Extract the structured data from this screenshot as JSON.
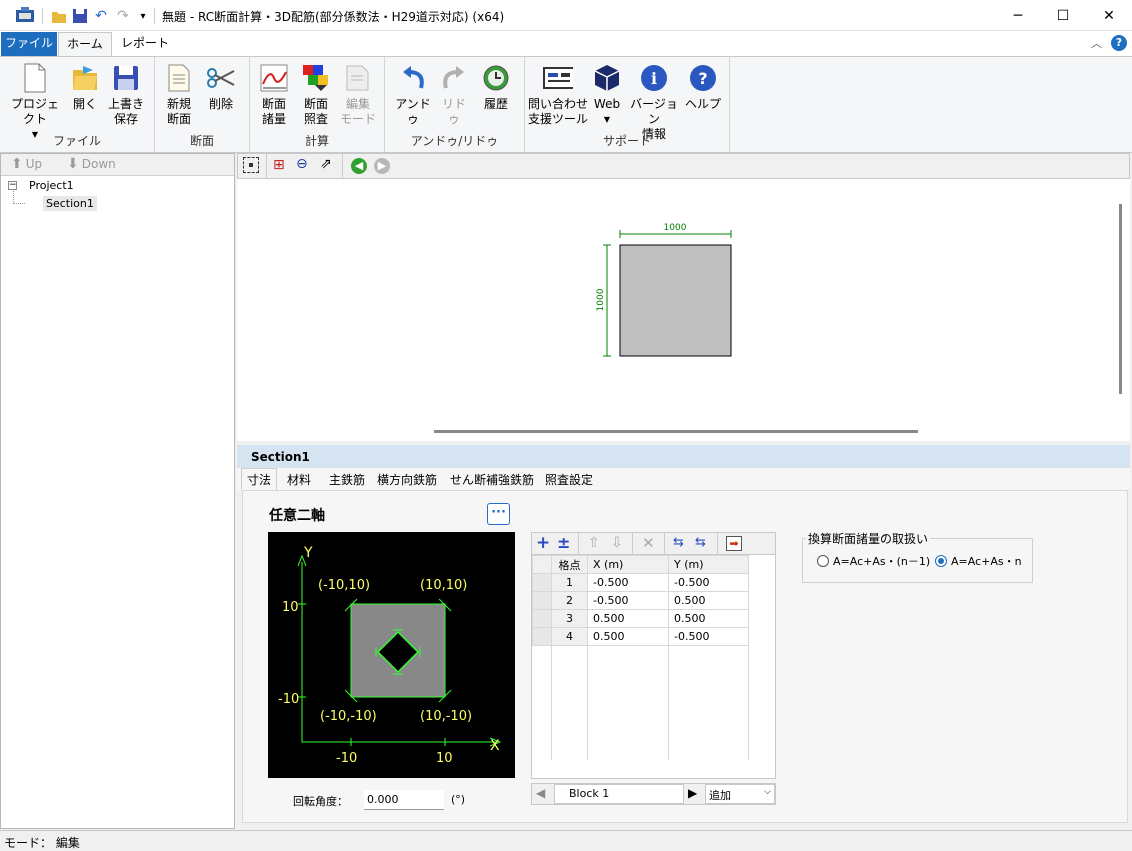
{
  "window": {
    "title": "無題 - RC断面計算・3D配筋(部分係数法・H29道示対応) (x64)",
    "minimize": "─",
    "maximize": "☐",
    "close": "✕"
  },
  "ribbon_tabs": [
    "ファイル",
    "ホーム",
    "レポート"
  ],
  "ribbon": {
    "groups": {
      "file": "ファイル",
      "section": "断面",
      "calc": "計算",
      "undo": "アンドゥ/リドゥ",
      "support": "サポート"
    },
    "buttons": {
      "project": "プロジェクト",
      "open": "開く",
      "save_l1": "上書き",
      "save_l2": "保存",
      "new_l1": "新規",
      "new_l2": "断面",
      "delete": "削除",
      "props_l1": "断面",
      "props_l2": "諸量",
      "check_l1": "断面",
      "check_l2": "照査",
      "edit_l1": "編集",
      "edit_l2": "モード",
      "undo": "アンドゥ",
      "redo": "リドゥ",
      "history": "履歴",
      "inquiry_l1": "問い合わせ",
      "inquiry_l2": "支援ツール",
      "web": "Web",
      "version_l1": "バージョン",
      "version_l2": "情報",
      "help": "ヘルプ"
    }
  },
  "left": {
    "up": "Up",
    "down": "Down",
    "tree": {
      "project": "Project1",
      "section": "Section1"
    }
  },
  "canvas": {
    "width_label": "1000",
    "height_label": "1000"
  },
  "section": {
    "title": "Section1",
    "tabs": [
      "寸法",
      "材料",
      "主鉄筋",
      "横方向鉄筋",
      "せん断補強鉄筋",
      "照査設定"
    ],
    "axis_title": "任意二軸",
    "more_button": "···",
    "diagram": {
      "y_axis": "Y",
      "x_axis": "X",
      "tick_pos": "10",
      "tick_neg": "-10",
      "corner_tl": "(-10,10)",
      "corner_tr": "(10,10)",
      "corner_bl": "(-10,-10)",
      "corner_br": "(10,-10)"
    },
    "rotation_label": "回転角度：",
    "rotation_value": "0.000",
    "rotation_unit": "(°)",
    "grid": {
      "headers": [
        "格点",
        "X (m)",
        "Y (m)"
      ],
      "rows": [
        [
          "1",
          "-0.500",
          "-0.500"
        ],
        [
          "2",
          "-0.500",
          "0.500"
        ],
        [
          "3",
          "0.500",
          "0.500"
        ],
        [
          "4",
          "0.500",
          "-0.500"
        ]
      ]
    },
    "block_tab": "Block 1",
    "add_select": "追加",
    "handling": {
      "title": "換算断面諸量の取扱い",
      "option1": "A=Ac+As・(n－1)",
      "option2": "A=Ac+As・n",
      "selected": "option2"
    }
  },
  "status": "モード： 編集",
  "colors": {
    "accent": "#1e6ec0",
    "section_fill": "#c0c0c0",
    "dimension": "#008000",
    "diagram_bg": "#000000",
    "diagram_green": "#33ff33",
    "diagram_yellow": "#ffff66"
  }
}
